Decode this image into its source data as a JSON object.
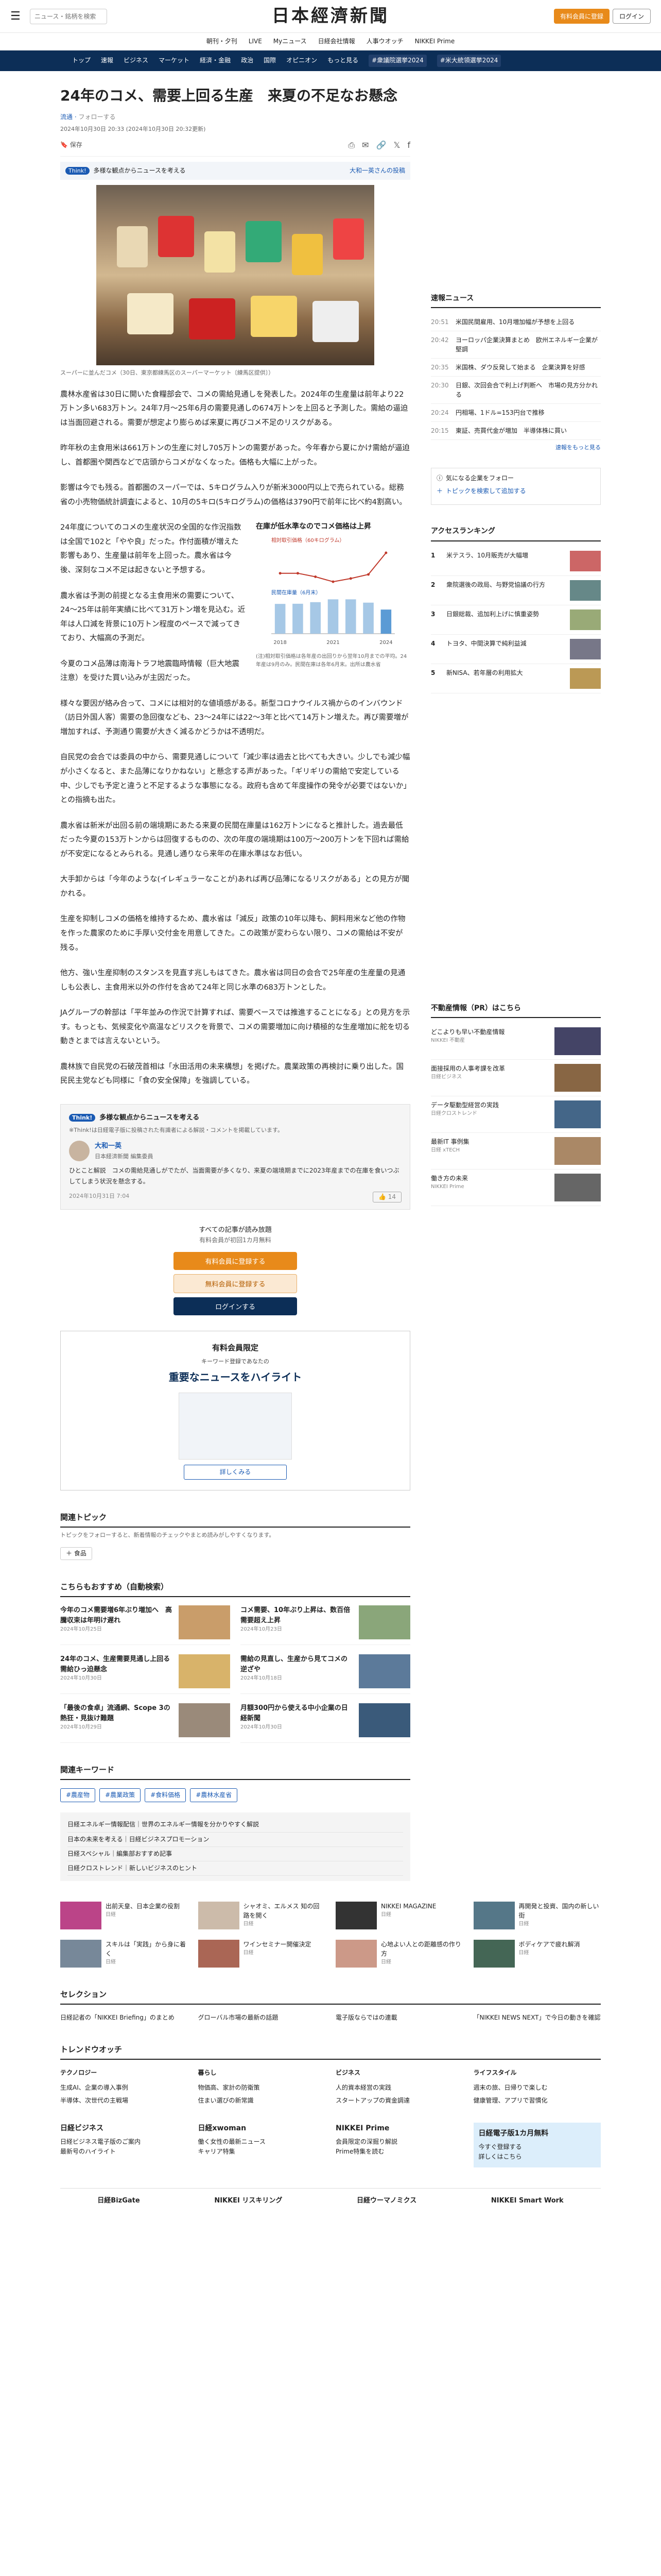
{
  "header": {
    "search_placeholder": "ニュース・銘柄を検索",
    "logo": "日本經濟新聞",
    "signup": "有料会員に登録",
    "login": "ログイン"
  },
  "sub_nav": [
    "朝刊・夕刊",
    "LIVE",
    "Myニュース",
    "日経会社情報",
    "人事ウオッチ",
    "NIKKEI Prime"
  ],
  "main_nav": [
    "トップ",
    "速報",
    "ビジネス",
    "マーケット",
    "経済・金融",
    "政治",
    "国際",
    "オピニオン",
    "もっと見る"
  ],
  "main_nav_tags": [
    "#衆議院選挙2024",
    "#米大統領選挙2024"
  ],
  "article": {
    "title": "24年のコメ、需要上回る生産　来夏の不足なお懸念",
    "section": "流通",
    "follow": "フォローする",
    "date": "2024年10月30日 20:33 (2024年10月30日 20:32更新)",
    "save_label": "保存",
    "think_text": "多様な観点からニュースを考える",
    "think_link": "大和一英さんの投稿",
    "photo_caption": "スーパーに並んだコメ（30日、東京都練馬区のスーパーマーケット〔練馬区提供〕）",
    "paragraphs": [
      "農林水産省は30日に開いた食糧部会で、コメの需給見通しを発表した。2024年の生産量は前年より22万トン多い683万トン。24年7月～25年6月の需要見通しの674万トンを上回ると予測した。需給の逼迫は当面回避される。需要が想定より膨らめば来夏に再びコメ不足のリスクがある。",
      "昨年秋の主食用米は661万トンの生産に対し705万トンの需要があった。今年春から夏にかけ需給が逼迫し、首都圏や関西などで店頭からコメがなくなった。価格も大幅に上がった。",
      "影響は今でも残る。首都圏のスーパーでは、5キログラム入りが新米3000円以上で売られている。総務省の小売物価統計調査によると、10月の5キロ(5キログラム)の価格は3790円で前年に比べ約4割高い。",
      "24年度についてのコメの生産状況の全国的な作況指数は全国で102と「やや良」だった。作付面積が増えた影響もあり、生産量は前年を上回った。農水省は今後、深刻なコメ不足は起きないと予想する。",
      "農水省は予測の前提となる主食用米の需要について、24～25年は前年実績に比べて31万トン増を見込む。近年は人口減を背景に10万トン程度のペースで減ってきており、大幅高の予測だ。",
      "今夏のコメ品薄は南海トラフ地震臨時情報（巨大地震注意）を受けた買い込みが主因だった。",
      "様々な要因が絡み合って、コメには相対的な値頃感がある。新型コロナウイルス禍からのインバウンド（訪日外国人客）需要の急回復なども、23～24年には22～3年と比べて14万トン増えた。再び需要増が増加すれば、予測通り需要が大きく減るかどうかは不透明だ。",
      "自民党の会合では委員の中から、需要見通しについて「減少率は過去と比べても大きい。少しでも減少幅が小さくなると、また品薄になりかねない」と懸念する声があった。「ギリギリの需給で安定している中、少しでも予定と違うと不足するような事態になる。政府も含めて年度操作の発令が必要ではないか」との指摘も出た。",
      "農水省は新米が出回る前の端境期にあたる来夏の民間在庫量は162万トンになると推計した。過去最低だった今夏の153万トンからは回復するものの、次の年度の端境期は100万～200万トンを下回れば需給が不安定になるとみられる。見通し通りなら来年の在庫水準はなお低い。",
      "大手卸からは「今年のような(イレギュラーなことが)あれば再び品薄になるリスクがある」との見方が聞かれる。",
      "生産を抑制しコメの価格を維持するため、農水省は「減反」政策の10年以降も、飼料用米など他の作物を作った農家のために手厚い交付金を用意してきた。この政策が変わらない限り、コメの需給は不安が残る。",
      "他方、強い生産抑制のスタンスを見直す兆しもはてきた。農水省は同日の会合で25年産の生産量の見通しも公表し、主食用米以外の作付を含めて24年と同じ水準の683万トンとした。",
      "JAグループの幹部は「平年並みの作況で計算すれば、需要ベースでは推進することになる」との見方を示す。もっとも、気候変化や高温などリスクを背景で、コメの需要増加に向け積極的な生産増加に舵を切る動きとまでは言えないという。",
      "農林族で自民党の石破茂首相は「水田活用の未来構想」を掲げた。農業政策の再検討に乗り出した。国民民主党なども同様に「食の安全保障」を強調している。"
    ],
    "chart_title": "在庫が低水準なのでコメ価格は上昇",
    "chart_note": "(注)相対取引価格は各年産の出回りから翌年10月までの平均。24年産は9月のみ。民間在庫は各年6月末。出所は農水省"
  },
  "chart_data": [
    {
      "type": "bar",
      "title": "民間在庫量（6月末）",
      "ylabel": "万トン",
      "categories": [
        "2018",
        "2019",
        "2020",
        "2021",
        "2022",
        "2023",
        "2024"
      ],
      "values": [
        189,
        190,
        200,
        218,
        218,
        197,
        153
      ],
      "ylim": [
        0,
        250
      ]
    },
    {
      "type": "line",
      "title": "相対取引価格",
      "ylabel": "60キログラム",
      "series": [
        {
          "name": "相対取引価格",
          "values": [
            15.7,
            15.7,
            14.5,
            12.8,
            13.9,
            15.3,
            22.7
          ]
        }
      ],
      "categories": [
        "2018",
        "2019",
        "2020",
        "2021",
        "2022",
        "2023",
        "2024"
      ],
      "ylim": [
        10,
        25
      ]
    }
  ],
  "think": {
    "header": "多様な観点からニュースを考える",
    "sub": "※Think!は日経電子版に投稿された有識者による解説・コメントを掲載しています。",
    "name": "大和一英",
    "role": "日本経済新聞 編集委員",
    "text": "ひとこと解説　コメの需給見通しがでたが、当面需要が多くなり、来夏の端境期までに2023年産までの在庫を食いつぶしてしまう状況を懸念する。",
    "date": "2024年10月31日 7:04",
    "likes": "14"
  },
  "paywall": {
    "line1": "すべての記事が読み放題",
    "line2": "有料会員が初回1カ月無料",
    "btn1": "有料会員に登録する",
    "btn2": "無料会員に登録する",
    "btn3": "ログインする"
  },
  "highlight": {
    "tag": "有料会員限定",
    "desc": "キーワード登録であなたの",
    "feature": "重要なニュースをハイライト",
    "link": "詳しくみる"
  },
  "related": {
    "title": "関連トピック",
    "sub": "トピックをフォローすると、新着情報のチェックやまとめ読みがしやすくなります。",
    "topic": "食品"
  },
  "recommend": {
    "title": "こちらもおすすめ（自動検索）",
    "items": [
      {
        "text": "今年のコメ需要増6年ぶり増加へ　高騰収束は年明け遅れ",
        "time": "2024年10月25日"
      },
      {
        "text": "コメ需要、10年ぶり上昇は、数百倍需要超え上昇",
        "time": "2024年10月23日"
      },
      {
        "text": "24年のコメ、生産需要見通し上回る　需給ひっ迫懸念",
        "time": "2024年10月30日"
      },
      {
        "text": "需給の見直し、生産から見てコメの逆ざや",
        "time": "2024年10月18日"
      },
      {
        "text": "「最後の食卓」流通網、Scope 3の熱狂・見抜け難題",
        "time": "2024年10月29日"
      },
      {
        "text": "月額300円から使える中小企業の日経新聞",
        "time": "2024年10月30日"
      }
    ]
  },
  "keywords": {
    "title": "関連キーワード",
    "items": [
      "#農産物",
      "#農業政策",
      "#食料価格",
      "#農林水産省"
    ]
  },
  "ads": [
    "日経エネルギー情報配信｜世界のエネルギー情報を分かりやすく解説",
    "日本の未来を考える｜日経ビジネスプロモーション",
    "日経スペシャル｜編集部おすすめ記事",
    "日経クロストレンド｜新しいビジネスのヒント"
  ],
  "sidebar": {
    "flash_title": "速報ニュース",
    "flash": [
      {
        "time": "20:51",
        "text": "米国民間雇用、10月増加幅が予想を上回る"
      },
      {
        "text": "ヨーロッパ企業決算まとめ　欧州エネルギー企業が堅調",
        "time": "20:42"
      },
      {
        "text": "米国株、ダウ反発して始まる　企業決算を好感",
        "time": "20:35"
      },
      {
        "text": "日銀、次回会合で利上げ判断へ　市場の見方分かれる",
        "time": "20:30"
      },
      {
        "text": "円相場、1ドル=153円台で推移",
        "time": "20:24"
      },
      {
        "text": "東証、売買代金が増加　半導体株に買い",
        "time": "20:15"
      }
    ],
    "flash_more": "速報をもっと見る",
    "follow_label": "気になる企業をフォロー",
    "follow_link": "トピックを検索して追加する",
    "ranking_title": "アクセスランキング",
    "ranking": [
      "米テスラ、10月販売が大幅増",
      "衆院選後の政局、与野党協議の行方",
      "日銀総裁、追加利上げに慎重姿勢",
      "トヨタ、中間決算で純利益減",
      "新NISA、若年層の利用拡大"
    ],
    "pr_title": "不動産情報（PR）はこちら",
    "pr": [
      {
        "text": "どこよりも早い不動産情報",
        "src": "NIKKEI 不動産"
      },
      {
        "text": "面接採用の人事考課を改革",
        "src": "日経ビジネス"
      },
      {
        "text": "データ駆動型経営の実践",
        "src": "日経クロストレンド"
      },
      {
        "text": "最新IT 事例集",
        "src": "日経 xTECH"
      },
      {
        "text": "働き方の未来",
        "src": "NIKKEI Prime"
      }
    ]
  },
  "bottom": {
    "row1": [
      {
        "text": "出前天皇、日本企業の役割",
        "src": "日経"
      },
      {
        "text": "シャオミ、エルメス 知の回路を開く",
        "src": "日経"
      },
      {
        "text": "NIKKEI MAGAZINE",
        "src": "日経"
      },
      {
        "text": "再開発と投資、国内の新しい街",
        "src": "日経"
      }
    ],
    "row2": [
      {
        "text": "スキルは「実践」から身に着く",
        "src": "日経"
      },
      {
        "text": "ワインセミナー開催決定",
        "src": "日経"
      },
      {
        "text": "心地よい人との距離感の作り方",
        "src": "日経"
      },
      {
        "text": "ボディケアで疲れ解消",
        "src": "日経"
      }
    ],
    "selection_title": "セレクション",
    "selection": [
      "日経記者の「NIKKEI Briefing」のまとめ",
      "グローバル市場の最新の話題",
      "電子版ならではの連載",
      "「NIKKEI NEWS NEXT」で今日の動きを確認"
    ],
    "trend_title": "トレンドウオッチ",
    "trend_cols": [
      {
        "h": "テクノロジー",
        "items": [
          "生成AI、企業の導入事例",
          "半導体、次世代の主戦場"
        ]
      },
      {
        "h": "暮らし",
        "items": [
          "物価高、家計の防衛策",
          "住まい選びの新常識"
        ]
      },
      {
        "h": "ビジネス",
        "items": [
          "人的資本経営の実践",
          "スタートアップの資金調達"
        ]
      },
      {
        "h": "ライフスタイル",
        "items": [
          "週末の旅、日帰りで楽しむ",
          "健康管理、アプリで習慣化"
        ]
      }
    ],
    "services": [
      {
        "h": "日経ビジネス",
        "items": [
          "日経ビジネス電子版のご案内",
          "最新号のハイライト"
        ]
      },
      {
        "h": "日経xwoman",
        "items": [
          "働く女性の最新ニュース",
          "キャリア特集"
        ]
      },
      {
        "h": "NIKKEI Prime",
        "items": [
          "会員限定の深掘り解説",
          "Prime特集を読む"
        ]
      },
      {
        "h": "日経電子版1カ月無料",
        "items": [
          "今すぐ登録する",
          "詳しくはこちら"
        ]
      }
    ],
    "strip": [
      "日経BizGate",
      "NIKKEI リスキリング",
      "日経ウーマノミクス",
      "NIKKEI Smart Work"
    ]
  }
}
